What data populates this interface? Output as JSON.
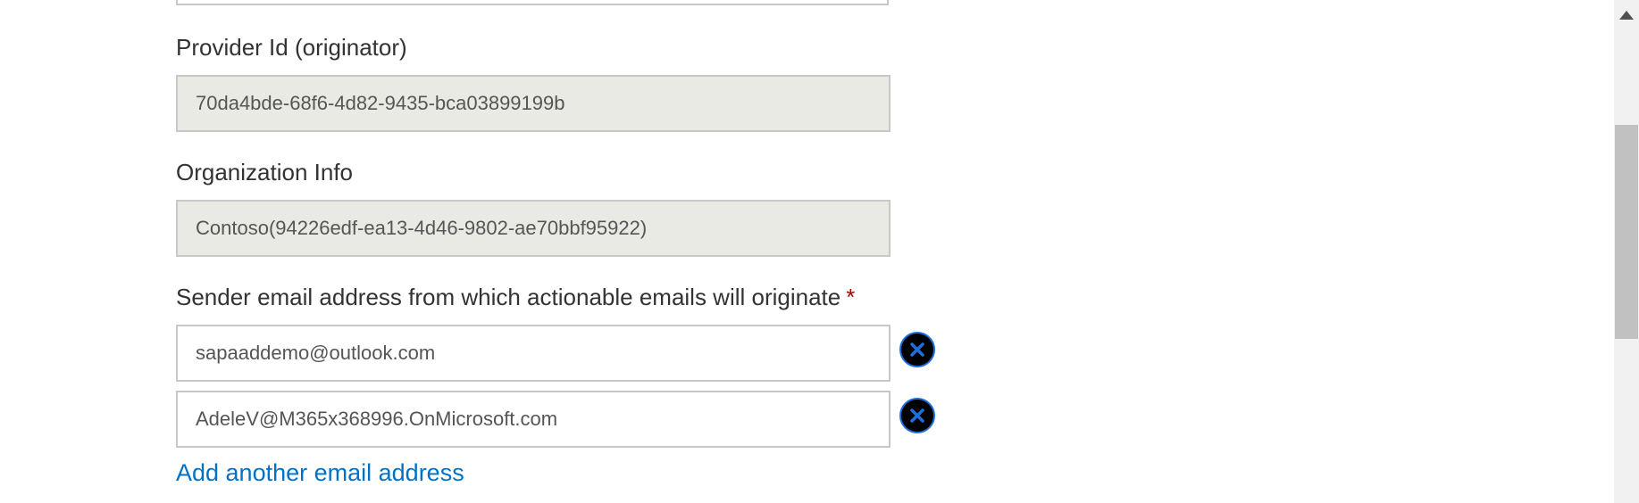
{
  "form": {
    "provider_id": {
      "label": "Provider Id (originator)",
      "value": "70da4bde-68f6-4d82-9435-bca03899199b"
    },
    "organization_info": {
      "label": "Organization Info",
      "value": "Contoso(94226edf-ea13-4d46-9802-ae70bbf95922)"
    },
    "sender_email": {
      "label": "Sender email address from which actionable emails will originate",
      "required_marker": "*",
      "emails": [
        "sapaaddemo@outlook.com",
        "AdeleV@M365x368996.OnMicrosoft.com"
      ],
      "add_link": "Add another email address"
    }
  },
  "icons": {
    "remove": "close-circle-icon",
    "scroll_up": "caret-up-icon"
  },
  "colors": {
    "link": "#0072c6",
    "required": "#a80000",
    "readonly_bg": "#eaeae5",
    "remove_button_bg": "#000000",
    "remove_button_accent": "#1e6fd9"
  }
}
